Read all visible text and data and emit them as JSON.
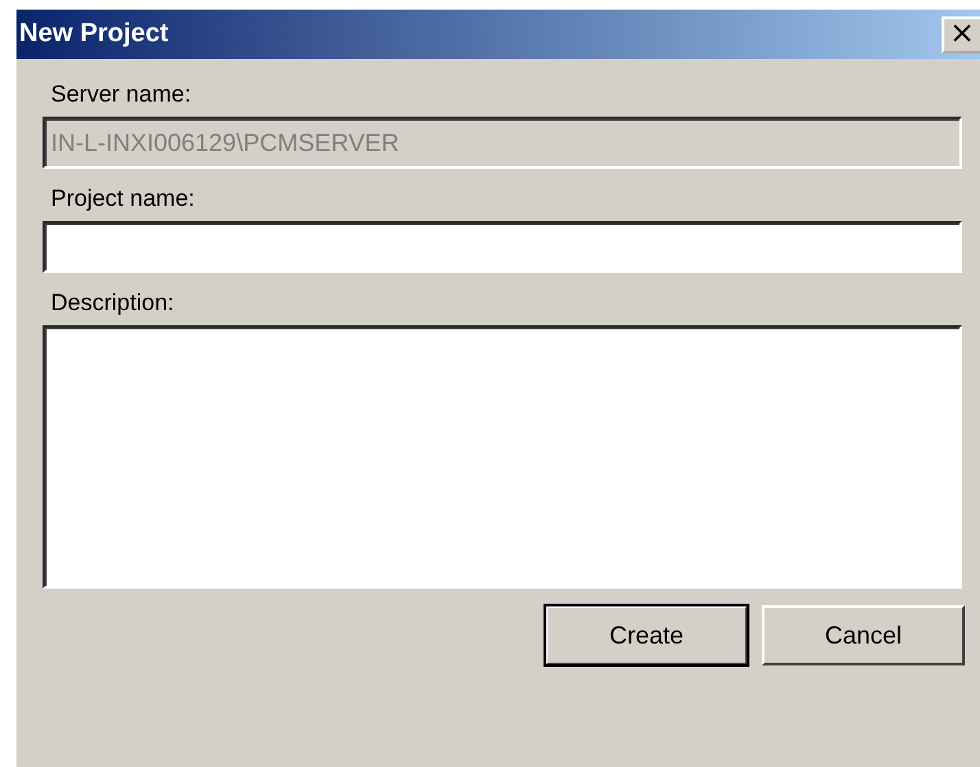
{
  "window": {
    "title": "New Project",
    "close": "×"
  },
  "fields": [
    {
      "label": "Server name:",
      "value": "IN-L-INXI006129\\PCMSERVER",
      "disabled": true,
      "kind": "line"
    },
    {
      "label": "Project name:",
      "disabled": false,
      "kind": "line"
    },
    {
      "label": "Description:",
      "disabled": false,
      "kind": "area"
    }
  ],
  "buttons": [
    {
      "label": "Create",
      "default": true
    },
    {
      "label": "Cancel",
      "default": false
    }
  ]
}
